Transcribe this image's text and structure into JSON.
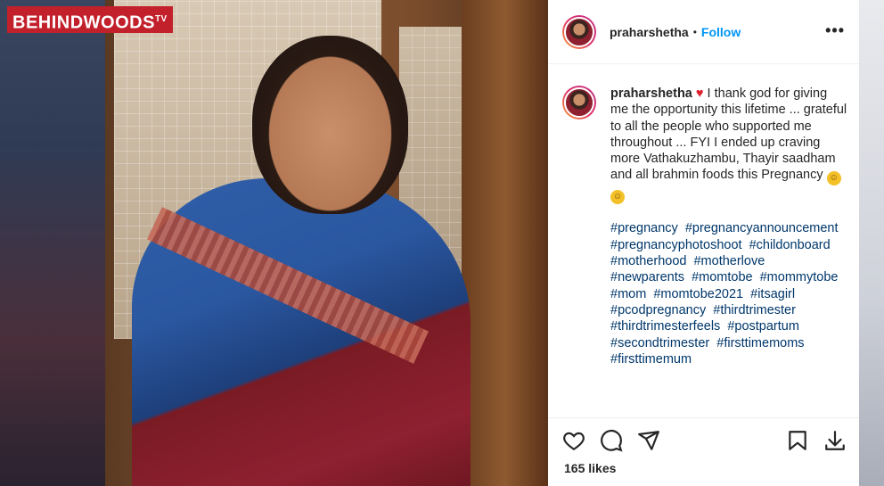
{
  "video_logo": {
    "text": "BEHINDWOODS",
    "tm": "TV"
  },
  "post": {
    "username": "praharshetha",
    "separator": "•",
    "follow_label": "Follow",
    "more_label": "•••",
    "caption_user": "praharshetha",
    "caption_heart": "♥",
    "caption_text": "I thank god for giving me the opportunity this lifetime ... grateful to all the people who supported me throughout ... FYI I ended up craving more Vathakuzhambu, Thayir saadham and all brahmin foods this Pregnancy",
    "emoji_1": "☺",
    "emoji_2": "☺",
    "hashtags": [
      "#pregnancy",
      "#pregnancyannouncement",
      "#pregnancyphotoshoot",
      "#childonboard",
      "#motherhood",
      "#motherlove",
      "#newparents",
      "#momtobe",
      "#mommytobe",
      "#mom",
      "#momtobe2021",
      "#itsagirl",
      "#pcodpregnancy",
      "#thirdtrimester",
      "#thirdtrimesterfeels",
      "#postpartum",
      "#secondtrimester",
      "#firsttimemoms",
      "#firsttimemum"
    ],
    "likes_text": "165 likes"
  },
  "icons": {
    "like": "heart-outline-icon",
    "comment": "comment-icon",
    "share": "share-icon",
    "save": "bookmark-icon",
    "download": "download-icon"
  }
}
